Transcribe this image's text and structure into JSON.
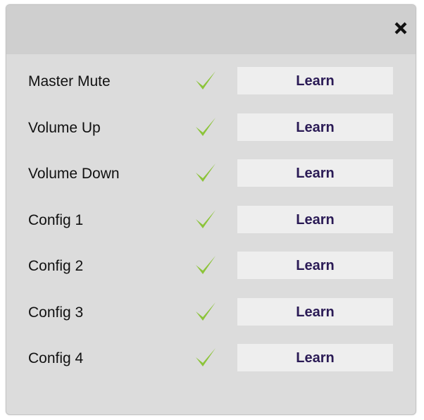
{
  "dialog": {
    "close_icon": "close-icon",
    "accent_check_color": "#8cc43a",
    "button_text_color": "#2a1a55"
  },
  "rows": [
    {
      "label": "Master Mute",
      "status_icon": "checkmark-icon",
      "button_label": "Learn"
    },
    {
      "label": "Volume Up",
      "status_icon": "checkmark-icon",
      "button_label": "Learn"
    },
    {
      "label": "Volume Down",
      "status_icon": "checkmark-icon",
      "button_label": "Learn"
    },
    {
      "label": "Config 1",
      "status_icon": "checkmark-icon",
      "button_label": "Learn"
    },
    {
      "label": "Config 2",
      "status_icon": "checkmark-icon",
      "button_label": "Learn"
    },
    {
      "label": "Config 3",
      "status_icon": "checkmark-icon",
      "button_label": "Learn"
    },
    {
      "label": "Config 4",
      "status_icon": "checkmark-icon",
      "button_label": "Learn"
    }
  ]
}
